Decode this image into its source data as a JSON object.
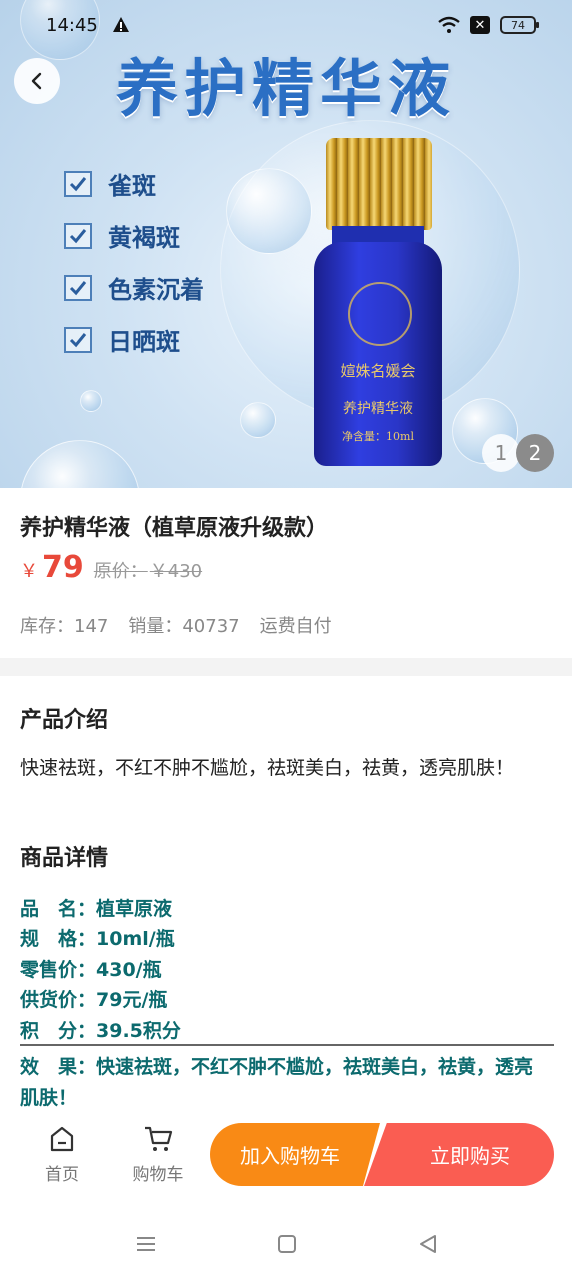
{
  "status_bar": {
    "time": "14:45",
    "battery": "74"
  },
  "hero": {
    "title": "养护精华液",
    "checks": [
      "雀斑",
      "黄褐斑",
      "色素沉着",
      "日晒斑"
    ],
    "bottle_brand": "媗姝名媛会",
    "bottle_name": "养护精华液",
    "bottle_volume": "净含量：10ml",
    "pager": [
      "1",
      "2"
    ]
  },
  "product": {
    "title": "养护精华液（植草原液升级款）",
    "currency": "￥",
    "price": "79",
    "original_label": "原价：",
    "original_price": "￥430",
    "stock": "库存：147",
    "sales": "销量：40737",
    "shipping": "运费自付"
  },
  "intro": {
    "title": "产品介绍",
    "text": "快速祛斑，不红不肿不尴尬，祛斑美白，祛黄，透亮肌肤！"
  },
  "details": {
    "title": "商品详情",
    "specs": [
      "品　名：植草原液",
      "规　格：10ml/瓶",
      "零售价：430/瓶",
      "供货价：79元/瓶",
      "积　分：39.5积分"
    ],
    "effect": "效　果：快速祛斑，不红不肿不尴尬，祛斑美白，祛黄，透亮肌肤！"
  },
  "action_bar": {
    "home_label": "首页",
    "cart_label": "购物车",
    "add_to_cart": "加入购物车",
    "buy_now": "立即购买",
    "colors": {
      "add": "#f98a15",
      "buy": "#fa5d52"
    }
  },
  "icons": [
    "back-arrow-icon",
    "home-icon",
    "cart-icon",
    "menu-icon",
    "square-icon",
    "triangle-back-icon"
  ]
}
